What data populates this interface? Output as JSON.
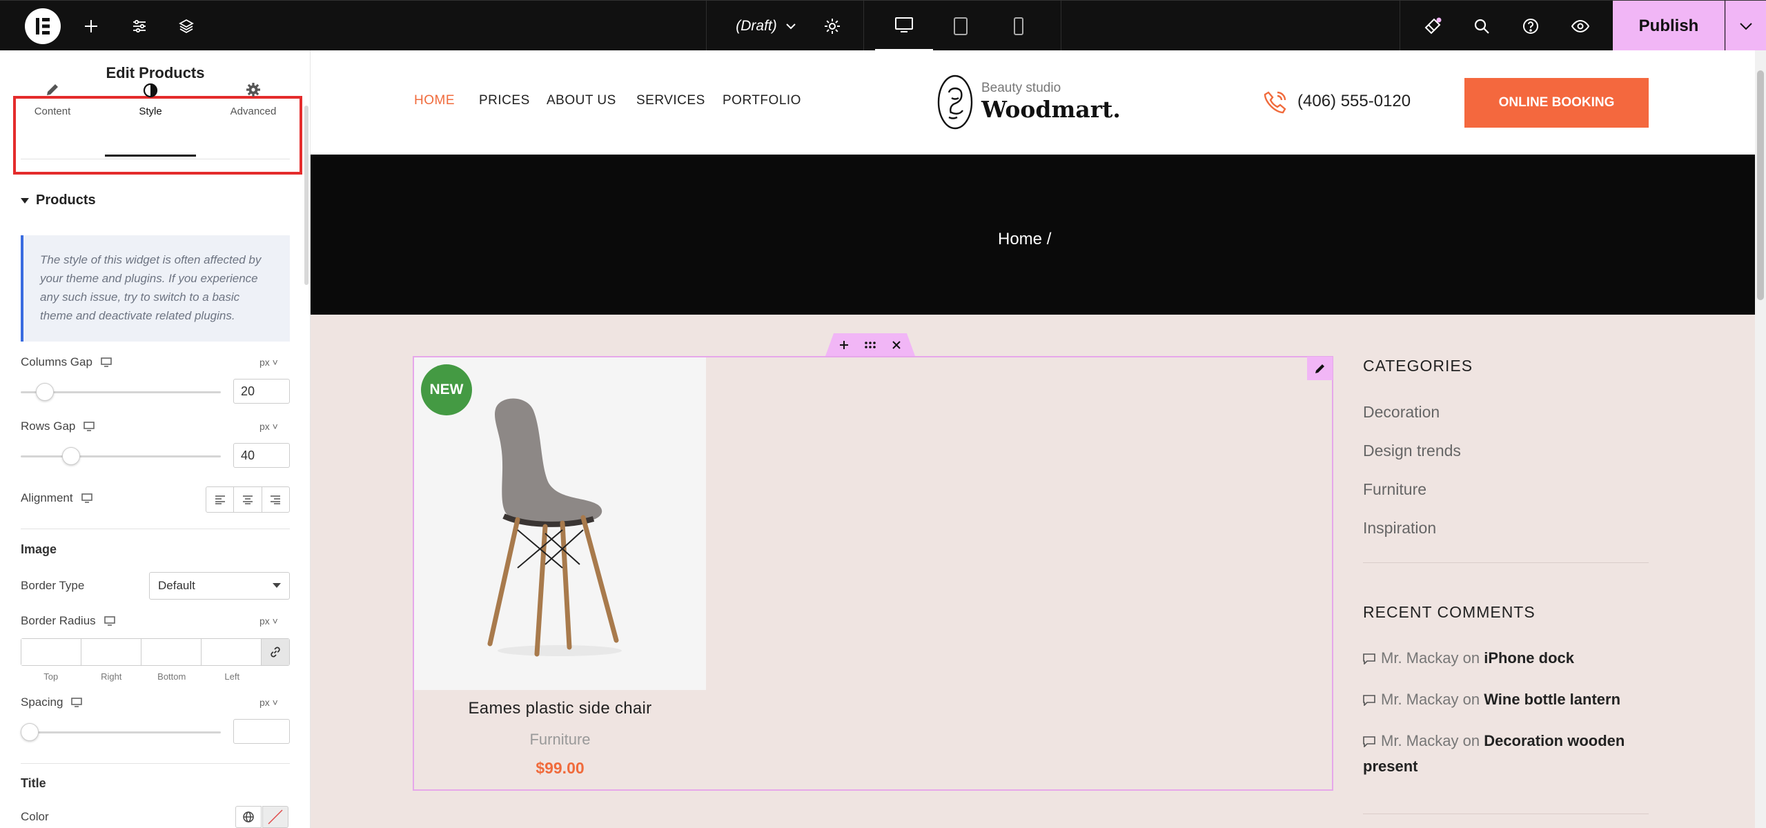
{
  "topbar": {
    "draft_label": "(Draft)",
    "publish_label": "Publish"
  },
  "panel": {
    "title": "Edit Products",
    "tabs": [
      {
        "label": "Content"
      },
      {
        "label": "Style"
      },
      {
        "label": "Advanced"
      }
    ],
    "section_title": "Products",
    "notice": "The style of this widget is often affected by your theme and plugins. If you experience any such issue, try to switch to a basic theme and deactivate related plugins.",
    "columns_gap": {
      "label": "Columns Gap",
      "unit": "px",
      "value": "20",
      "level": 0.12
    },
    "rows_gap": {
      "label": "Rows Gap",
      "unit": "px",
      "value": "40",
      "level": 0.25
    },
    "alignment_label": "Alignment",
    "image_heading": "Image",
    "border_type": {
      "label": "Border Type",
      "value": "Default"
    },
    "border_radius": {
      "label": "Border Radius",
      "unit": "px",
      "sides": [
        "Top",
        "Right",
        "Bottom",
        "Left"
      ]
    },
    "spacing": {
      "label": "Spacing",
      "unit": "px",
      "value": "",
      "level": 0
    },
    "title_heading": "Title",
    "color_label": "Color"
  },
  "site": {
    "nav": [
      "HOME",
      "PRICES",
      "ABOUT US",
      "SERVICES",
      "PORTFOLIO"
    ],
    "logo_sub": "Beauty studio",
    "logo_main": "Woodmart.",
    "phone": "(406) 555-0120",
    "booking": "ONLINE BOOKING",
    "breadcrumb": "Home  /",
    "product": {
      "badge": "NEW",
      "title": "Eames plastic side chair",
      "category": "Furniture",
      "price": "$99.00"
    },
    "categories_title": "CATEGORIES",
    "categories": [
      "Decoration",
      "Design trends",
      "Furniture",
      "Inspiration"
    ],
    "comments_title": "RECENT COMMENTS",
    "comments": [
      {
        "author": "Mr. Mackay",
        "on": "on",
        "post": "iPhone dock"
      },
      {
        "author": "Mr. Mackay",
        "on": "on",
        "post": "Wine bottle lantern"
      },
      {
        "author": "Mr. Mackay",
        "on": "on",
        "post": "Decoration wooden present"
      }
    ]
  },
  "colors": {
    "accent": "#f06b3c",
    "editor_pink": "#f1b6f6",
    "highlight_red": "#e42c2c",
    "badge_green": "#449a43",
    "content_bg": "#efe4e1"
  }
}
